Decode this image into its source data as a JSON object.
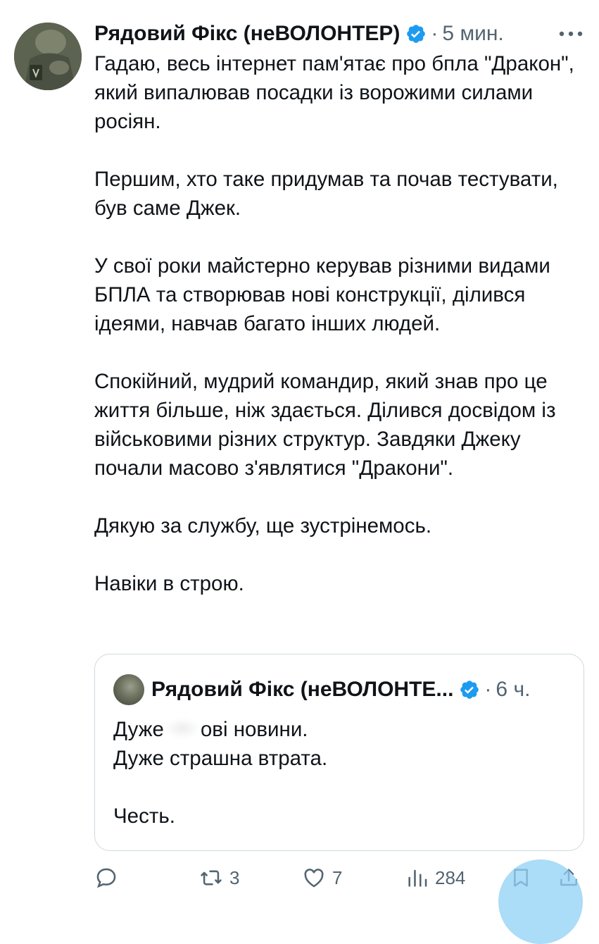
{
  "tweet": {
    "author_name": "Рядовий Фікс (неВОЛОНТЕР)",
    "separator": "·",
    "time": "5 мин.",
    "paragraphs": [
      "Гадаю, весь інтернет пам'ятає про бпла \"Дракон\", який випалював посадки із ворожими силами росіян.",
      "Першим, хто таке придумав та почав тестувати, був саме Джек.",
      "У свої роки майстерно керував різними видами БПЛА та створював нові конструкції, ділився ідеями, навчав багато інших людей.",
      "Спокійний, мудрий командир, який знав про це життя більше, ніж здається. Ділився досвідом із військовими різних структур. Завдяки Джеку почали масово з'являтися \"Дракони\".",
      "Дякую за службу, ще зустрінемось.",
      "Навіки в строю."
    ]
  },
  "quote": {
    "author_name": "Рядовий Фікс (неВОЛОНТЕ...",
    "separator": "·",
    "time": "6 ч.",
    "line1_start": "Дуже",
    "line1_end": "ові новини.",
    "line2": "Дуже страшна втрата.",
    "line3": "Честь."
  },
  "actions": {
    "replies": "",
    "reposts": "3",
    "likes": "7",
    "views": "284"
  },
  "colors": {
    "verified": "#1d9bf0",
    "secondary_text": "#536471",
    "text": "#0f1419",
    "border": "#cfd9de",
    "fab": "#8fd0f5"
  },
  "icons": {
    "verified": "verified-badge-icon",
    "more": "more-icon",
    "reply": "reply-icon",
    "repost": "repost-icon",
    "like": "heart-icon",
    "views": "views-icon",
    "bookmark": "bookmark-icon",
    "share": "share-icon"
  }
}
